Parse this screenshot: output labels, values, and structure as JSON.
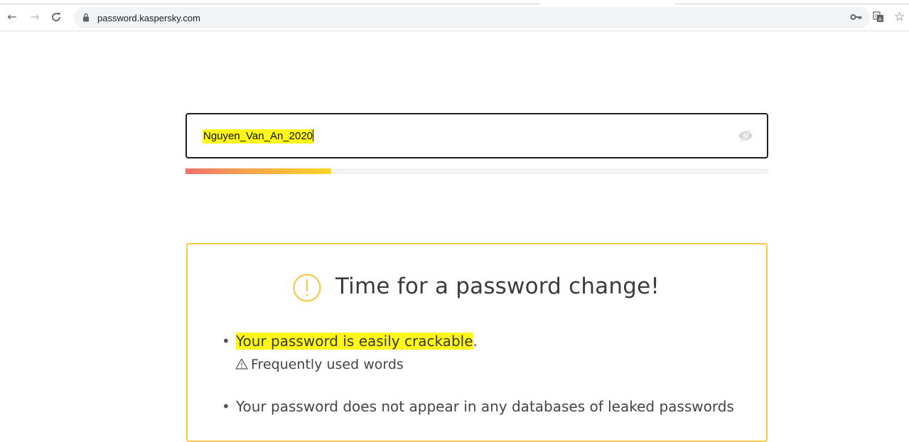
{
  "browser": {
    "url": "password.kaspersky.com",
    "nav": {
      "back": "←",
      "forward": "→",
      "reload": "C"
    },
    "tools": {
      "key": "🔑",
      "translate": "⌘",
      "star": "☆"
    }
  },
  "password_field": {
    "value": "Nguyen_Van_An_2020",
    "strength": 0.25
  },
  "result": {
    "title": "Time for a password change!",
    "items": [
      {
        "text": "Your password is easily crackable",
        "suffix": ".",
        "detail": "Frequently used words"
      },
      {
        "text": "Your password does not appear in any databases of leaked passwords"
      }
    ]
  },
  "colors": {
    "card_border": "#f9c84a",
    "highlight": "#fff71a",
    "meter_start": "#f36f6f",
    "meter_end": "#fbd72a"
  }
}
